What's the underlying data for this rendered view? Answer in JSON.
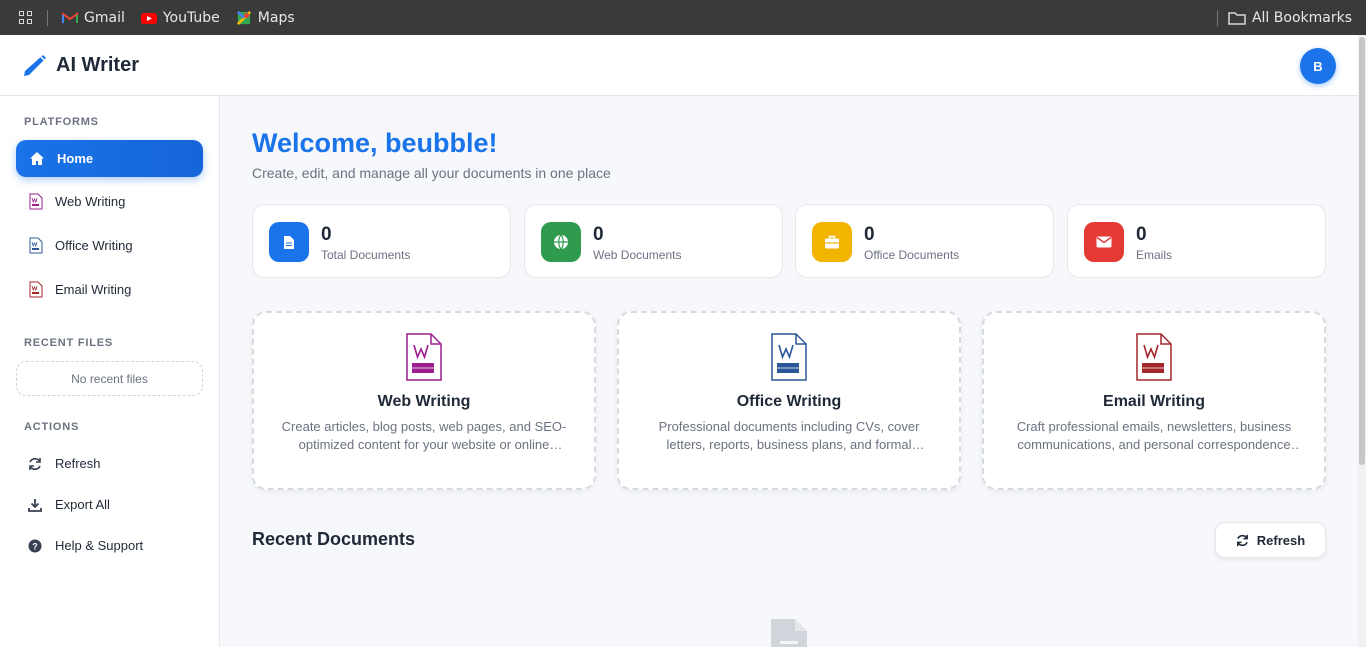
{
  "bookmarks": {
    "items": [
      {
        "label": "Gmail",
        "icon": "gmail-icon"
      },
      {
        "label": "YouTube",
        "icon": "youtube-icon"
      },
      {
        "label": "Maps",
        "icon": "maps-icon"
      }
    ],
    "all_bookmarks": "All Bookmarks"
  },
  "header": {
    "title": "AI Writer",
    "avatar_initial": "B"
  },
  "sidebar": {
    "platforms_heading": "PLATFORMS",
    "nav": [
      {
        "label": "Home",
        "icon": "home-icon",
        "active": true
      },
      {
        "label": "Web Writing",
        "icon": "web-doc-icon"
      },
      {
        "label": "Office Writing",
        "icon": "office-doc-icon"
      },
      {
        "label": "Email Writing",
        "icon": "email-doc-icon"
      }
    ],
    "recent_heading": "RECENT FILES",
    "no_recent": "No recent files",
    "actions_heading": "ACTIONS",
    "actions": [
      {
        "label": "Refresh",
        "icon": "refresh-icon"
      },
      {
        "label": "Export All",
        "icon": "download-icon"
      },
      {
        "label": "Help & Support",
        "icon": "help-icon"
      }
    ]
  },
  "main": {
    "welcome": "Welcome, beubble!",
    "subtitle": "Create, edit, and manage all your documents in one place",
    "stats": [
      {
        "value": "0",
        "label": "Total Documents",
        "icon": "file-icon",
        "color": "#1a73e8"
      },
      {
        "value": "0",
        "label": "Web Documents",
        "icon": "globe-icon",
        "color": "#2e9b4f"
      },
      {
        "value": "0",
        "label": "Office Documents",
        "icon": "briefcase-icon",
        "color": "#f2b400"
      },
      {
        "value": "0",
        "label": "Emails",
        "icon": "envelope-icon",
        "color": "#e53935"
      }
    ],
    "platforms": [
      {
        "title": "Web Writing",
        "desc": "Create articles, blog posts, web pages, and SEO-optimized content for your website or online presence.",
        "color": "#9c1f8f"
      },
      {
        "title": "Office Writing",
        "desc": "Professional documents including CVs, cover letters, reports, business plans, and formal documents.",
        "color": "#2b579a"
      },
      {
        "title": "Email Writing",
        "desc": "Craft professional emails, newsletters, business communications, and personal correspondence with ease.",
        "color": "#a4262c"
      }
    ],
    "recent_title": "Recent Documents",
    "refresh_label": "Refresh"
  },
  "colors": {
    "accent": "#1a73e8",
    "bookmarks_bar": "#3a3a3a"
  }
}
